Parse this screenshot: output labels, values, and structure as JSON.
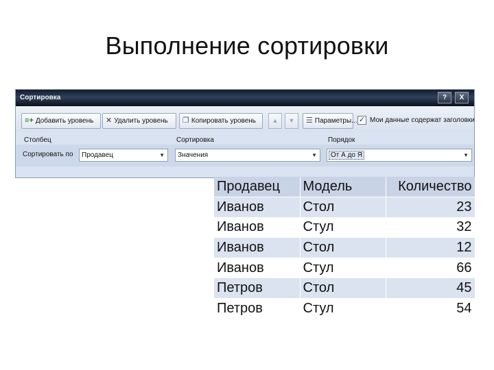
{
  "slide": {
    "title": "Выполнение сортировки"
  },
  "dialog": {
    "title": "Сортировка",
    "help_label": "?",
    "close_label": "X",
    "toolbar": {
      "add_level": "Добавить уровень",
      "delete_level": "Удалить уровень",
      "copy_level": "Копировать уровень",
      "up_arrow": "▲",
      "down_arrow": "▼",
      "parameters": "Параметры...",
      "has_headers_checked": "✓",
      "has_headers_label": "Мои данные содержат заголовки"
    },
    "headers": {
      "column": "Столбец",
      "sort_on": "Сортировка",
      "order": "Порядок"
    },
    "row": {
      "sort_by_label": "Сортировать по",
      "column_value": "Продавец",
      "sort_on_value": "Значения",
      "order_value": "От А до Я"
    }
  },
  "table": {
    "headers": [
      "Продавец",
      "Модель",
      "Количество"
    ],
    "rows": [
      [
        "Иванов",
        "Стол",
        "23"
      ],
      [
        "Иванов",
        "Стул",
        "32"
      ],
      [
        "Иванов",
        "Стол",
        "12"
      ],
      [
        "Иванов",
        "Стул",
        "66"
      ],
      [
        "Петров",
        "Стол",
        "45"
      ],
      [
        "Петров",
        "Стул",
        "54"
      ]
    ]
  },
  "colors": {
    "dialog_bg": "#d9e3f1",
    "titlebar": "#1d2838",
    "table_header": "#c9d3e6",
    "table_odd_row": "#dbe3f0"
  }
}
